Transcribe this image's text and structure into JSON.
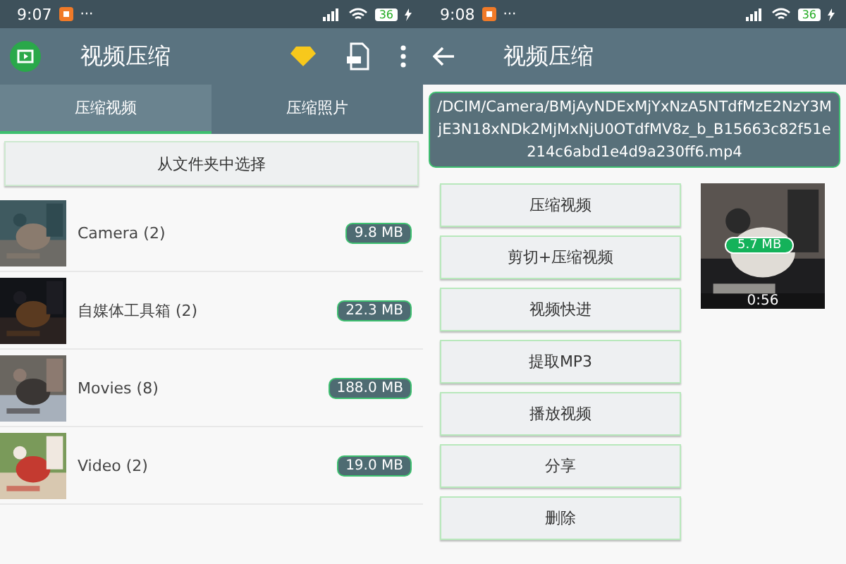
{
  "left_screen": {
    "status_bar": {
      "time": "9:07",
      "more": "···",
      "battery": "36"
    },
    "app_bar": {
      "title": "视频压缩"
    },
    "tabs": [
      {
        "label": "压缩视频",
        "selected": true
      },
      {
        "label": "压缩照片",
        "selected": false
      }
    ],
    "choose_button": "从文件夹中选择",
    "folders": [
      {
        "name": "Camera (2)",
        "size": "9.8 MB",
        "kind": "picture"
      },
      {
        "name": "自媒体工具箱 (2)",
        "size": "22.3 MB",
        "kind": "picture"
      },
      {
        "name": "Movies (8)",
        "size": "188.0 MB",
        "kind": "picture"
      },
      {
        "name": "Video (2)",
        "size": "19.0 MB",
        "kind": "picture"
      }
    ]
  },
  "right_screen": {
    "status_bar": {
      "time": "9:08",
      "more": "···",
      "battery": "36"
    },
    "app_bar": {
      "title": "视频压缩"
    },
    "file_path": "/DCIM/Camera/BMjAyNDExMjYxNzA5NTdfMzE2NzY3MjE3N18xNDk2MjMxNjU0OTdfMV8z_b_B15663c82f51e214c6abd1e4d9a230ff6.mp4",
    "actions": [
      "压缩视频",
      "剪切+压缩视频",
      "视频快进",
      "提取MP3",
      "播放视频",
      "分享",
      "删除"
    ],
    "preview": {
      "kind": "picture",
      "size": "5.7 MB",
      "duration": "0:56"
    }
  }
}
